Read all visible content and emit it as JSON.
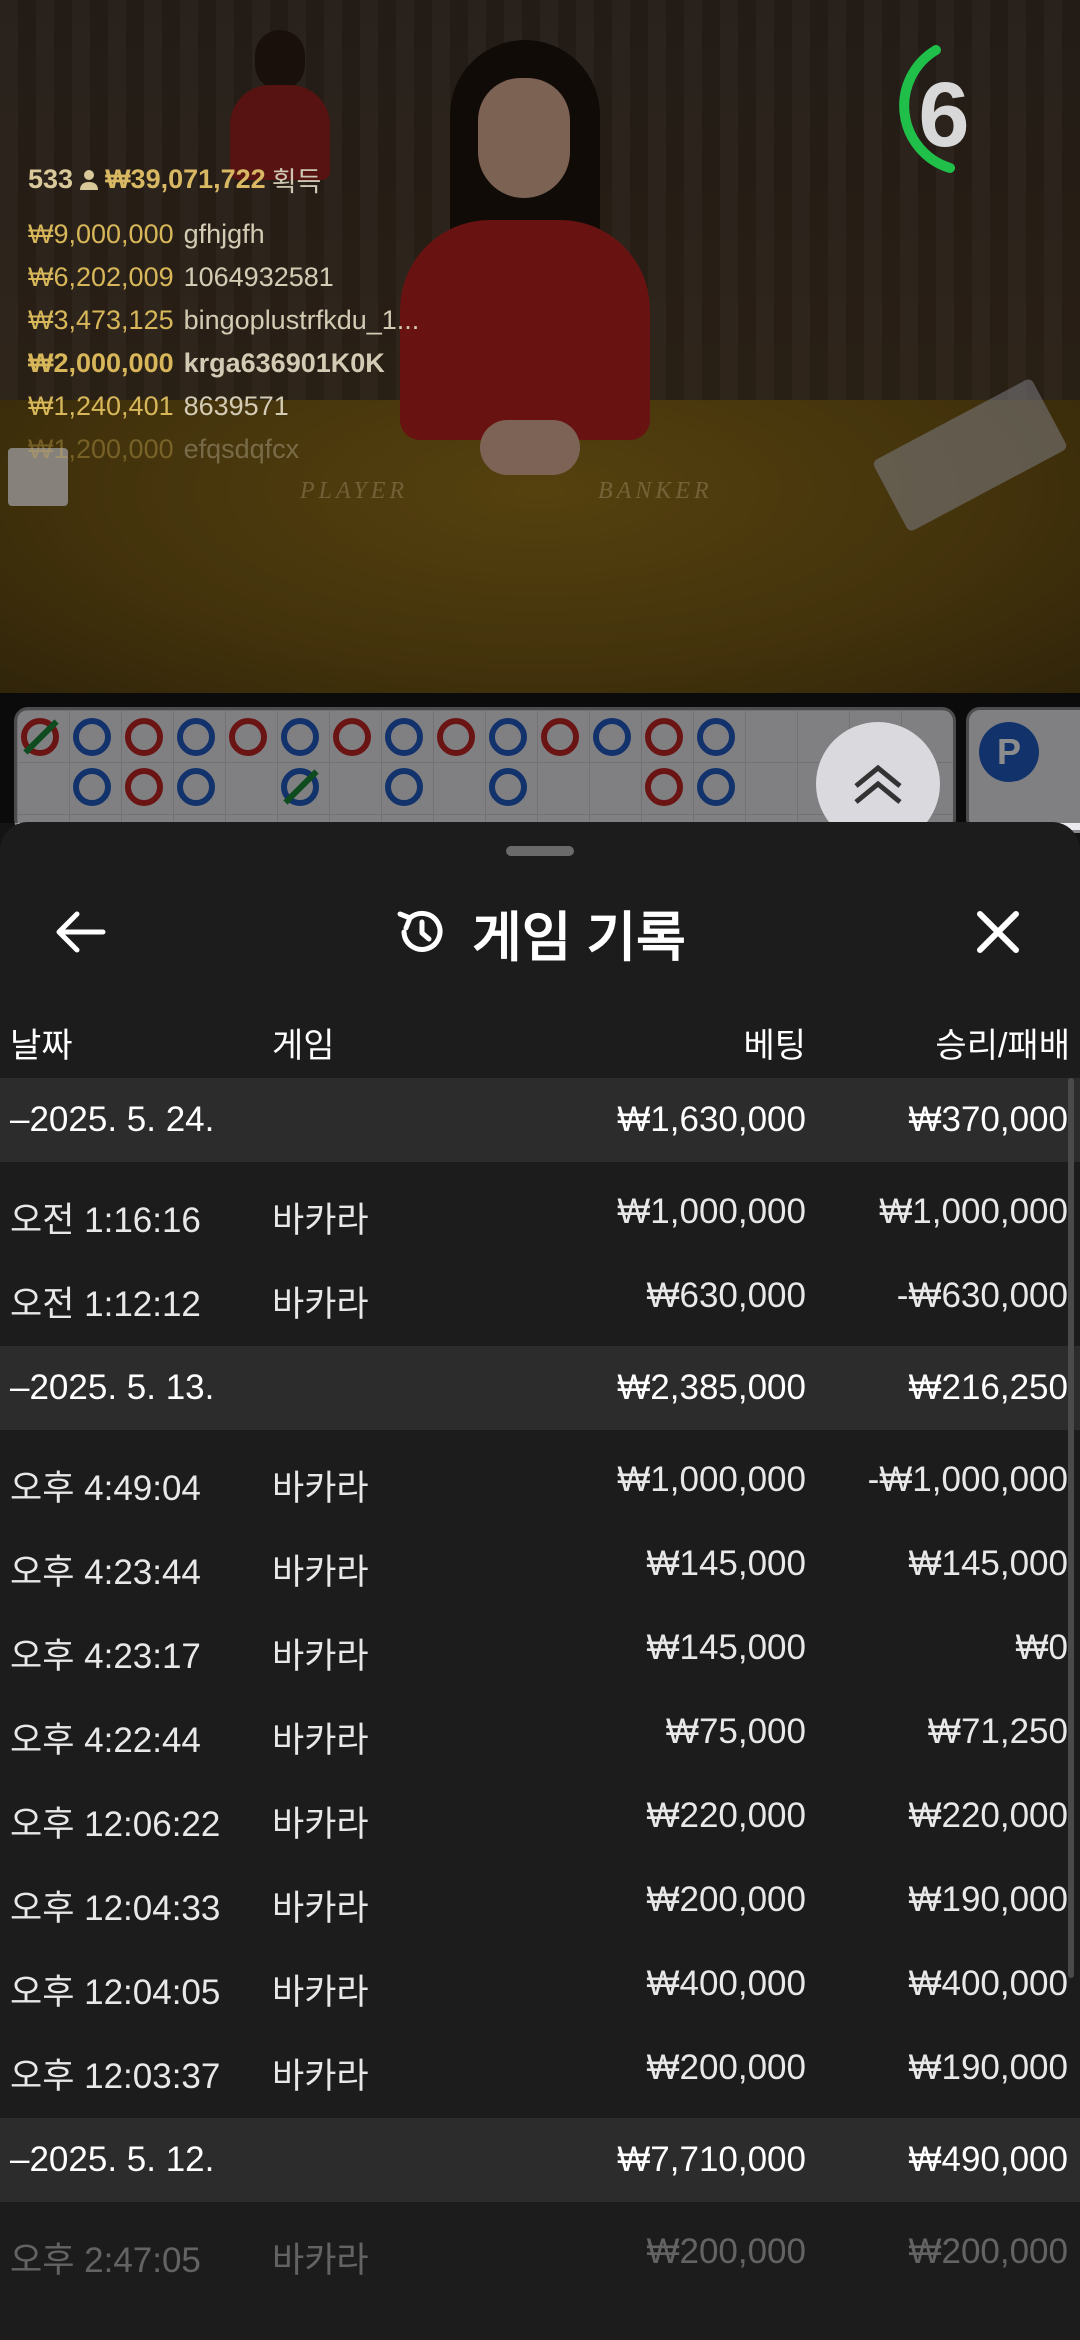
{
  "video": {
    "table_labels": [
      "PLAYER",
      "BANKER"
    ],
    "timer": "6",
    "winners": {
      "count": "533",
      "total": "₩39,071,722",
      "earned_label": "획득",
      "list": [
        {
          "amount": "₩9,000,000",
          "name": "gfhjgfh",
          "bold": false
        },
        {
          "amount": "₩6,202,009",
          "name": "1064932581",
          "bold": false
        },
        {
          "amount": "₩3,473,125",
          "name": "bingoplustrfkdu_1...",
          "bold": false
        },
        {
          "amount": "₩2,000,000",
          "name": "krga636901K0K",
          "bold": true
        },
        {
          "amount": "₩1,240,401",
          "name": "8639571",
          "bold": false
        },
        {
          "amount": "₩1,200,000",
          "name": "efqsdqfcx",
          "bold": false
        }
      ]
    }
  },
  "road": {
    "badge": "P"
  },
  "history": {
    "title": "게임 기록",
    "columns": {
      "date": "날짜",
      "game": "게임",
      "bet": "베팅",
      "win": "승리/패배"
    },
    "rows": [
      {
        "type": "group",
        "date": "–2025. 5. 24.",
        "bet": "₩1,630,000",
        "win": "₩370,000"
      },
      {
        "type": "item",
        "date": "오전 1:16:16",
        "game": "바카라",
        "bet": "₩1,000,000",
        "win": "₩1,000,000"
      },
      {
        "type": "item",
        "date": "오전 1:12:12",
        "game": "바카라",
        "bet": "₩630,000",
        "win": "-₩630,000"
      },
      {
        "type": "group",
        "date": "–2025. 5. 13.",
        "bet": "₩2,385,000",
        "win": "₩216,250"
      },
      {
        "type": "item",
        "date": "오후 4:49:04",
        "game": "바카라",
        "bet": "₩1,000,000",
        "win": "-₩1,000,000"
      },
      {
        "type": "item",
        "date": "오후 4:23:44",
        "game": "바카라",
        "bet": "₩145,000",
        "win": "₩145,000"
      },
      {
        "type": "item",
        "date": "오후 4:23:17",
        "game": "바카라",
        "bet": "₩145,000",
        "win": "₩0"
      },
      {
        "type": "item",
        "date": "오후 4:22:44",
        "game": "바카라",
        "bet": "₩75,000",
        "win": "₩71,250"
      },
      {
        "type": "item",
        "date": "오후 12:06:22",
        "game": "바카라",
        "bet": "₩220,000",
        "win": "₩220,000"
      },
      {
        "type": "item",
        "date": "오후 12:04:33",
        "game": "바카라",
        "bet": "₩200,000",
        "win": "₩190,000"
      },
      {
        "type": "item",
        "date": "오후 12:04:05",
        "game": "바카라",
        "bet": "₩400,000",
        "win": "₩400,000"
      },
      {
        "type": "item",
        "date": "오후 12:03:37",
        "game": "바카라",
        "bet": "₩200,000",
        "win": "₩190,000"
      },
      {
        "type": "group",
        "date": "–2025. 5. 12.",
        "bet": "₩7,710,000",
        "win": "₩490,000"
      },
      {
        "type": "item",
        "date": "오후 2:47:05",
        "game": "바카라",
        "bet": "₩200,000",
        "win": "₩200,000",
        "fade": true
      }
    ]
  },
  "colors": {
    "accent_green": "#1fbf4a",
    "player_blue": "#1f5bc4",
    "banker_red": "#c42525",
    "sheet_bg": "#1c1c1c",
    "group_bg": "#2c2c2c"
  },
  "icons": {
    "back": "arrow-left-icon",
    "history": "history-clock-icon",
    "close": "close-icon",
    "expand": "chevron-double-up-icon"
  }
}
